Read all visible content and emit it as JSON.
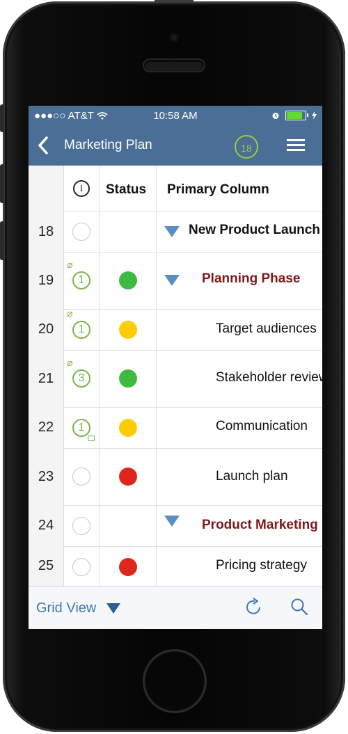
{
  "status_bar": {
    "carrier": "●●●○○ AT&T",
    "time": "10:58 AM"
  },
  "nav": {
    "title": "Marketing Plan",
    "badge_count": "18"
  },
  "grid": {
    "headers": {
      "status": "Status",
      "primary": "Primary Column"
    },
    "rows": [
      {
        "num": "18",
        "primary": "New Product Launch",
        "style": "bold"
      },
      {
        "num": "19",
        "info_count": "1",
        "status": "green",
        "primary": "Planning Phase",
        "style": "maroon"
      },
      {
        "num": "20",
        "info_count": "1",
        "status": "yellow",
        "primary": "Target audiences"
      },
      {
        "num": "21",
        "info_count": "3",
        "status": "green",
        "primary": "Stakeholder review"
      },
      {
        "num": "22",
        "info_count": "1",
        "status": "yellow",
        "primary": "Communication"
      },
      {
        "num": "23",
        "status": "red",
        "primary": "Launch plan"
      },
      {
        "num": "24",
        "primary": "Product Marketing",
        "style": "maroon"
      },
      {
        "num": "25",
        "status": "red",
        "primary": "Pricing strategy"
      }
    ]
  },
  "toolbar": {
    "view_label": "Grid View"
  },
  "colors": {
    "nav_bg": "#4b6e96",
    "green": "#3dba3f",
    "yellow": "#ffcc00",
    "red": "#e0261b",
    "accent": "#79b74a",
    "maroon": "#7d1a1a"
  }
}
